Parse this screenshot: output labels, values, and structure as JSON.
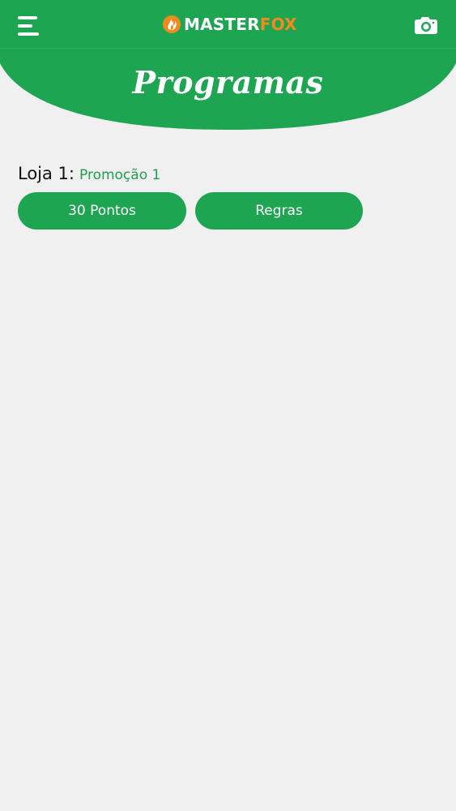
{
  "header": {
    "logo_master": "MASTER",
    "logo_fox": "FOX",
    "menu_icon": "hamburger-menu-icon",
    "camera_icon": "camera-icon",
    "colors": {
      "header_green": "#1ea552",
      "logo_orange": "#f28a1e",
      "background": "#f0f0f0"
    }
  },
  "page": {
    "title": "Programas"
  },
  "programs": [
    {
      "store_label": "Loja 1:",
      "promotion_name": "Promoção 1",
      "points_label": "30 Pontos",
      "rules_label": "Regras"
    }
  ]
}
